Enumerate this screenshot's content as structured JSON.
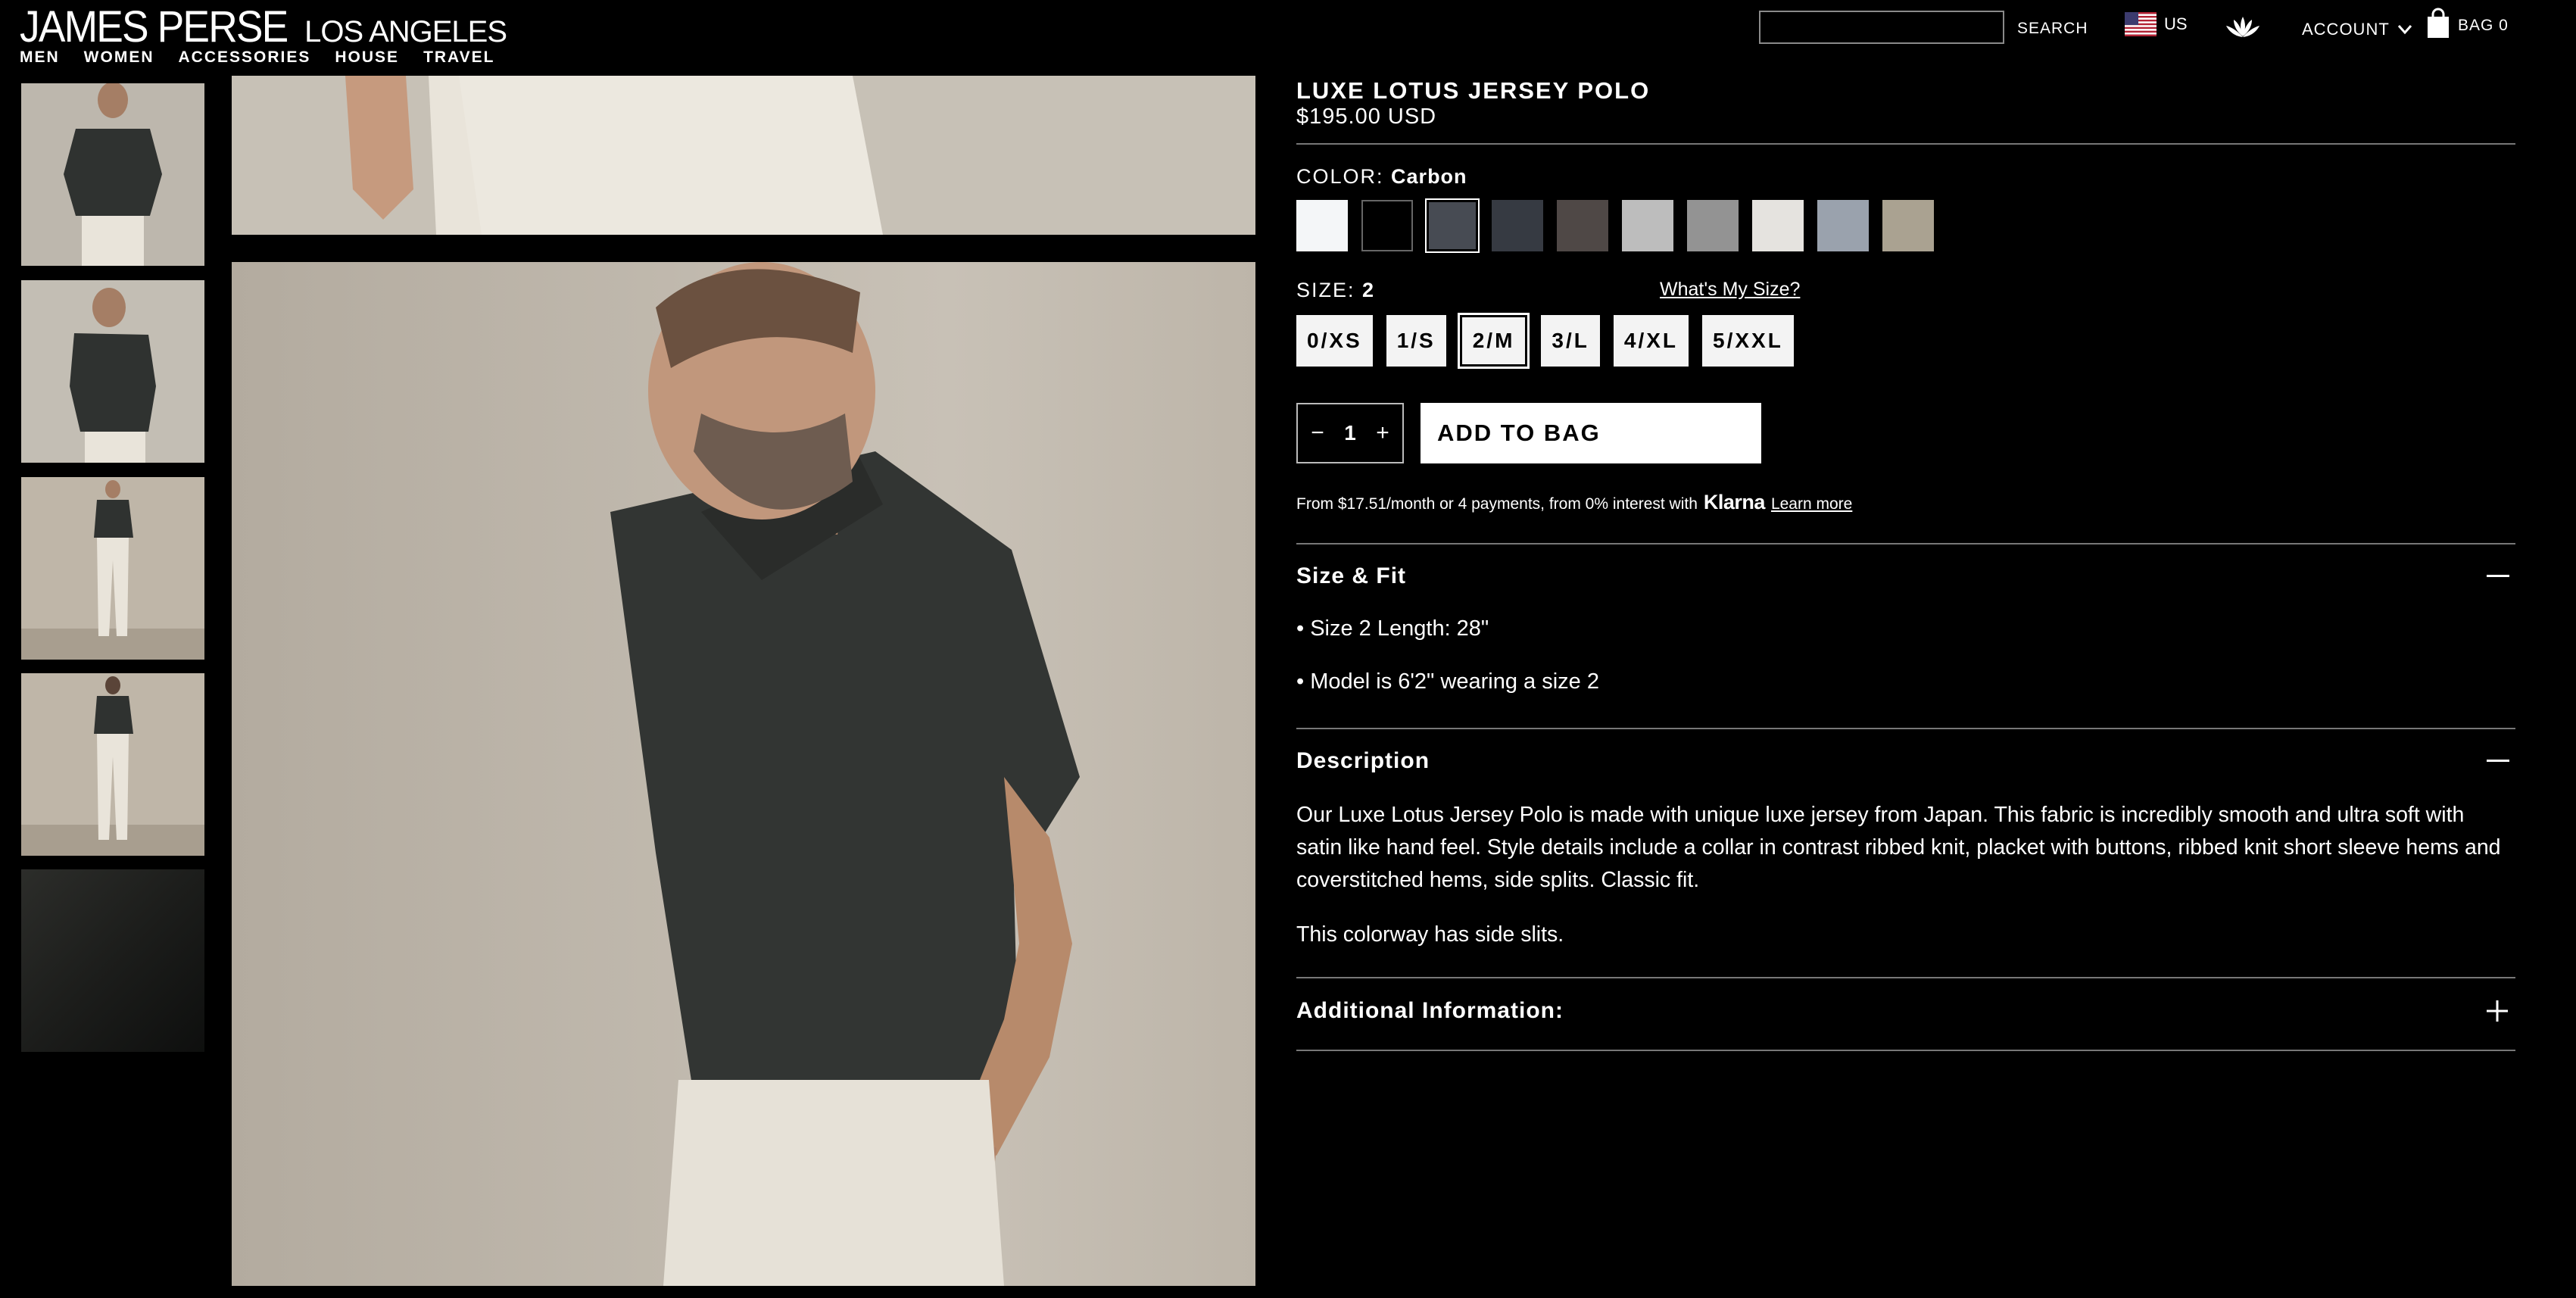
{
  "brand": {
    "name": "JAMES PERSE",
    "location": "LOS ANGELES"
  },
  "nav": [
    "MEN",
    "WOMEN",
    "ACCESSORIES",
    "HOUSE",
    "TRAVEL"
  ],
  "header": {
    "search_value": "",
    "search_label": "SEARCH",
    "country": "US",
    "account": "ACCOUNT",
    "bag": "BAG 0"
  },
  "product": {
    "title": "LUXE LOTUS JERSEY POLO",
    "price": "$195.00 USD",
    "color_label": "COLOR:",
    "color_value": "Carbon",
    "swatches": [
      {
        "name": "White",
        "color": "#f4f6f8"
      },
      {
        "name": "Black",
        "color": "#000000"
      },
      {
        "name": "Carbon",
        "color": "#474b53"
      },
      {
        "name": "Dark Slate",
        "color": "#363a42"
      },
      {
        "name": "Brown Stone",
        "color": "#4f4846"
      },
      {
        "name": "Heather Grey",
        "color": "#bdbdbd"
      },
      {
        "name": "Grey",
        "color": "#939393"
      },
      {
        "name": "Natural",
        "color": "#e5e3df"
      },
      {
        "name": "Blue Grey",
        "color": "#9aa2ad"
      },
      {
        "name": "Taupe",
        "color": "#aaa291"
      }
    ],
    "size_label": "SIZE:",
    "size_value": "2",
    "size_help": "What's My Size?",
    "sizes": [
      "0/XS",
      "1/S",
      "2/M",
      "3/L",
      "4/XL",
      "5/XXL"
    ],
    "quantity": "1",
    "add_to_bag": "ADD TO BAG",
    "klarna_text": "From $17.51/month or 4 payments, from 0% interest with",
    "klarna_brand": "Klarna",
    "klarna_link": "Learn more"
  },
  "size_fit": {
    "title": "Size & Fit",
    "items": [
      "• Size 2 Length: 28\"",
      "• Model is 6'2\" wearing a size 2"
    ]
  },
  "description": {
    "title": "Description",
    "text": "Our Luxe Lotus Jersey Polo is made with unique luxe jersey from Japan. This fabric is incredibly smooth and ultra soft with satin like hand feel. Style details include a collar in contrast ribbed knit, placket with buttons, ribbed knit short sleeve hems and coverstitched hems, side splits. Classic fit.",
    "note": "This colorway has side slits."
  },
  "additional": {
    "title": "Additional Information:"
  },
  "icons": {
    "minus": "minus-icon",
    "plus": "plus-icon",
    "bag": "bag-icon",
    "lotus": "lotus-logo-icon",
    "flag": "us-flag-icon",
    "chevron": "chevron-down-icon"
  }
}
